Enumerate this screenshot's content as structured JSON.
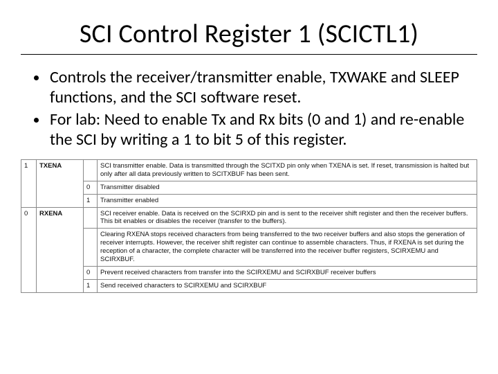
{
  "title": "SCI Control Register 1 (SCICTL1)",
  "bullets": [
    "Controls the receiver/transmitter enable, TXWAKE and SLEEP functions, and the SCI software reset.",
    "For lab: Need to enable Tx and Rx bits (0 and 1) and re-enable the SCI by writing a 1 to bit 5 of this register."
  ],
  "register": {
    "rows": [
      {
        "bit": "1",
        "name": "TXENA",
        "desc": "SCI transmitter enable. Data is transmitted through the SCITXD pin only when TXENA is set. If reset, transmission is halted but only after all data previously written to SCITXBUF has been sent.",
        "values": [
          {
            "val": "0",
            "text": "Transmitter disabled"
          },
          {
            "val": "1",
            "text": "Transmitter enabled"
          }
        ]
      },
      {
        "bit": "0",
        "name": "RXENA",
        "desc": "SCI receiver enable. Data is received on the SCIRXD pin and is sent to the receiver shift register and then the receiver buffers. This bit enables or disables the receiver (transfer to the buffers).",
        "extra": "Clearing RXENA stops received characters from being transferred to the two receiver buffers and also stops the generation of receiver interrupts. However, the receiver shift register can continue to assemble characters. Thus, if RXENA is set during the reception of a character, the complete character will be transferred into the receiver buffer registers, SCIRXEMU and SCIRXBUF.",
        "values": [
          {
            "val": "0",
            "text": "Prevent received characters from transfer into the SCIRXEMU and SCIRXBUF receiver buffers"
          },
          {
            "val": "1",
            "text": "Send received characters to SCIRXEMU and SCIRXBUF"
          }
        ]
      }
    ]
  }
}
